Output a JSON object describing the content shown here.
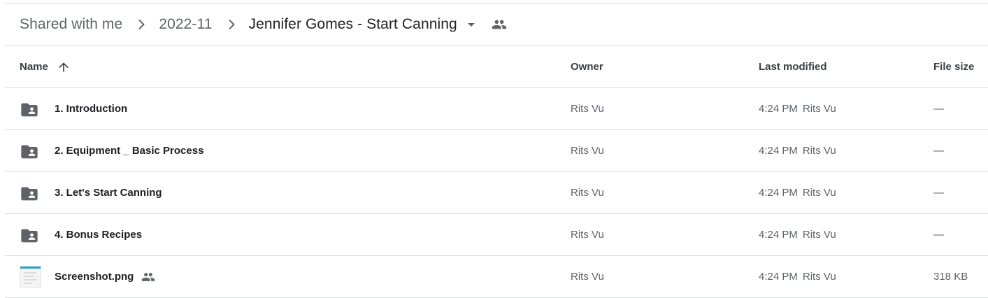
{
  "breadcrumb": {
    "items": [
      "Shared with me",
      "2022-11",
      "Jennifer Gomes - Start Canning"
    ],
    "separator_icon": "chevron-right-icon",
    "dropdown_icon": "arrow-drop-down-icon",
    "shared_icon": "people-icon"
  },
  "columns": {
    "name": "Name",
    "owner": "Owner",
    "last_modified": "Last modified",
    "file_size": "File size",
    "sort_icon": "arrow-upward-icon"
  },
  "files": [
    {
      "name": "1. Introduction",
      "type": "shared-folder",
      "owner": "Rits Vu",
      "modified_time": "4:24 PM",
      "modified_by": "Rits Vu",
      "size": "—"
    },
    {
      "name": "2. Equipment _ Basic Process",
      "type": "shared-folder",
      "owner": "Rits Vu",
      "modified_time": "4:24 PM",
      "modified_by": "Rits Vu",
      "size": "—"
    },
    {
      "name": "3. Let's Start Canning",
      "type": "shared-folder",
      "owner": "Rits Vu",
      "modified_time": "4:24 PM",
      "modified_by": "Rits Vu",
      "size": "—"
    },
    {
      "name": "4. Bonus Recipes",
      "type": "shared-folder",
      "owner": "Rits Vu",
      "modified_time": "4:24 PM",
      "modified_by": "Rits Vu",
      "size": "—"
    },
    {
      "name": "Screenshot.png",
      "type": "image",
      "owner": "Rits Vu",
      "modified_time": "4:24 PM",
      "modified_by": "Rits Vu",
      "size": "318 KB",
      "shared": true
    }
  ],
  "colors": {
    "divider": "#dadce0",
    "icon": "#5f6368",
    "text_primary": "#202124",
    "text_secondary": "#5f6368"
  }
}
